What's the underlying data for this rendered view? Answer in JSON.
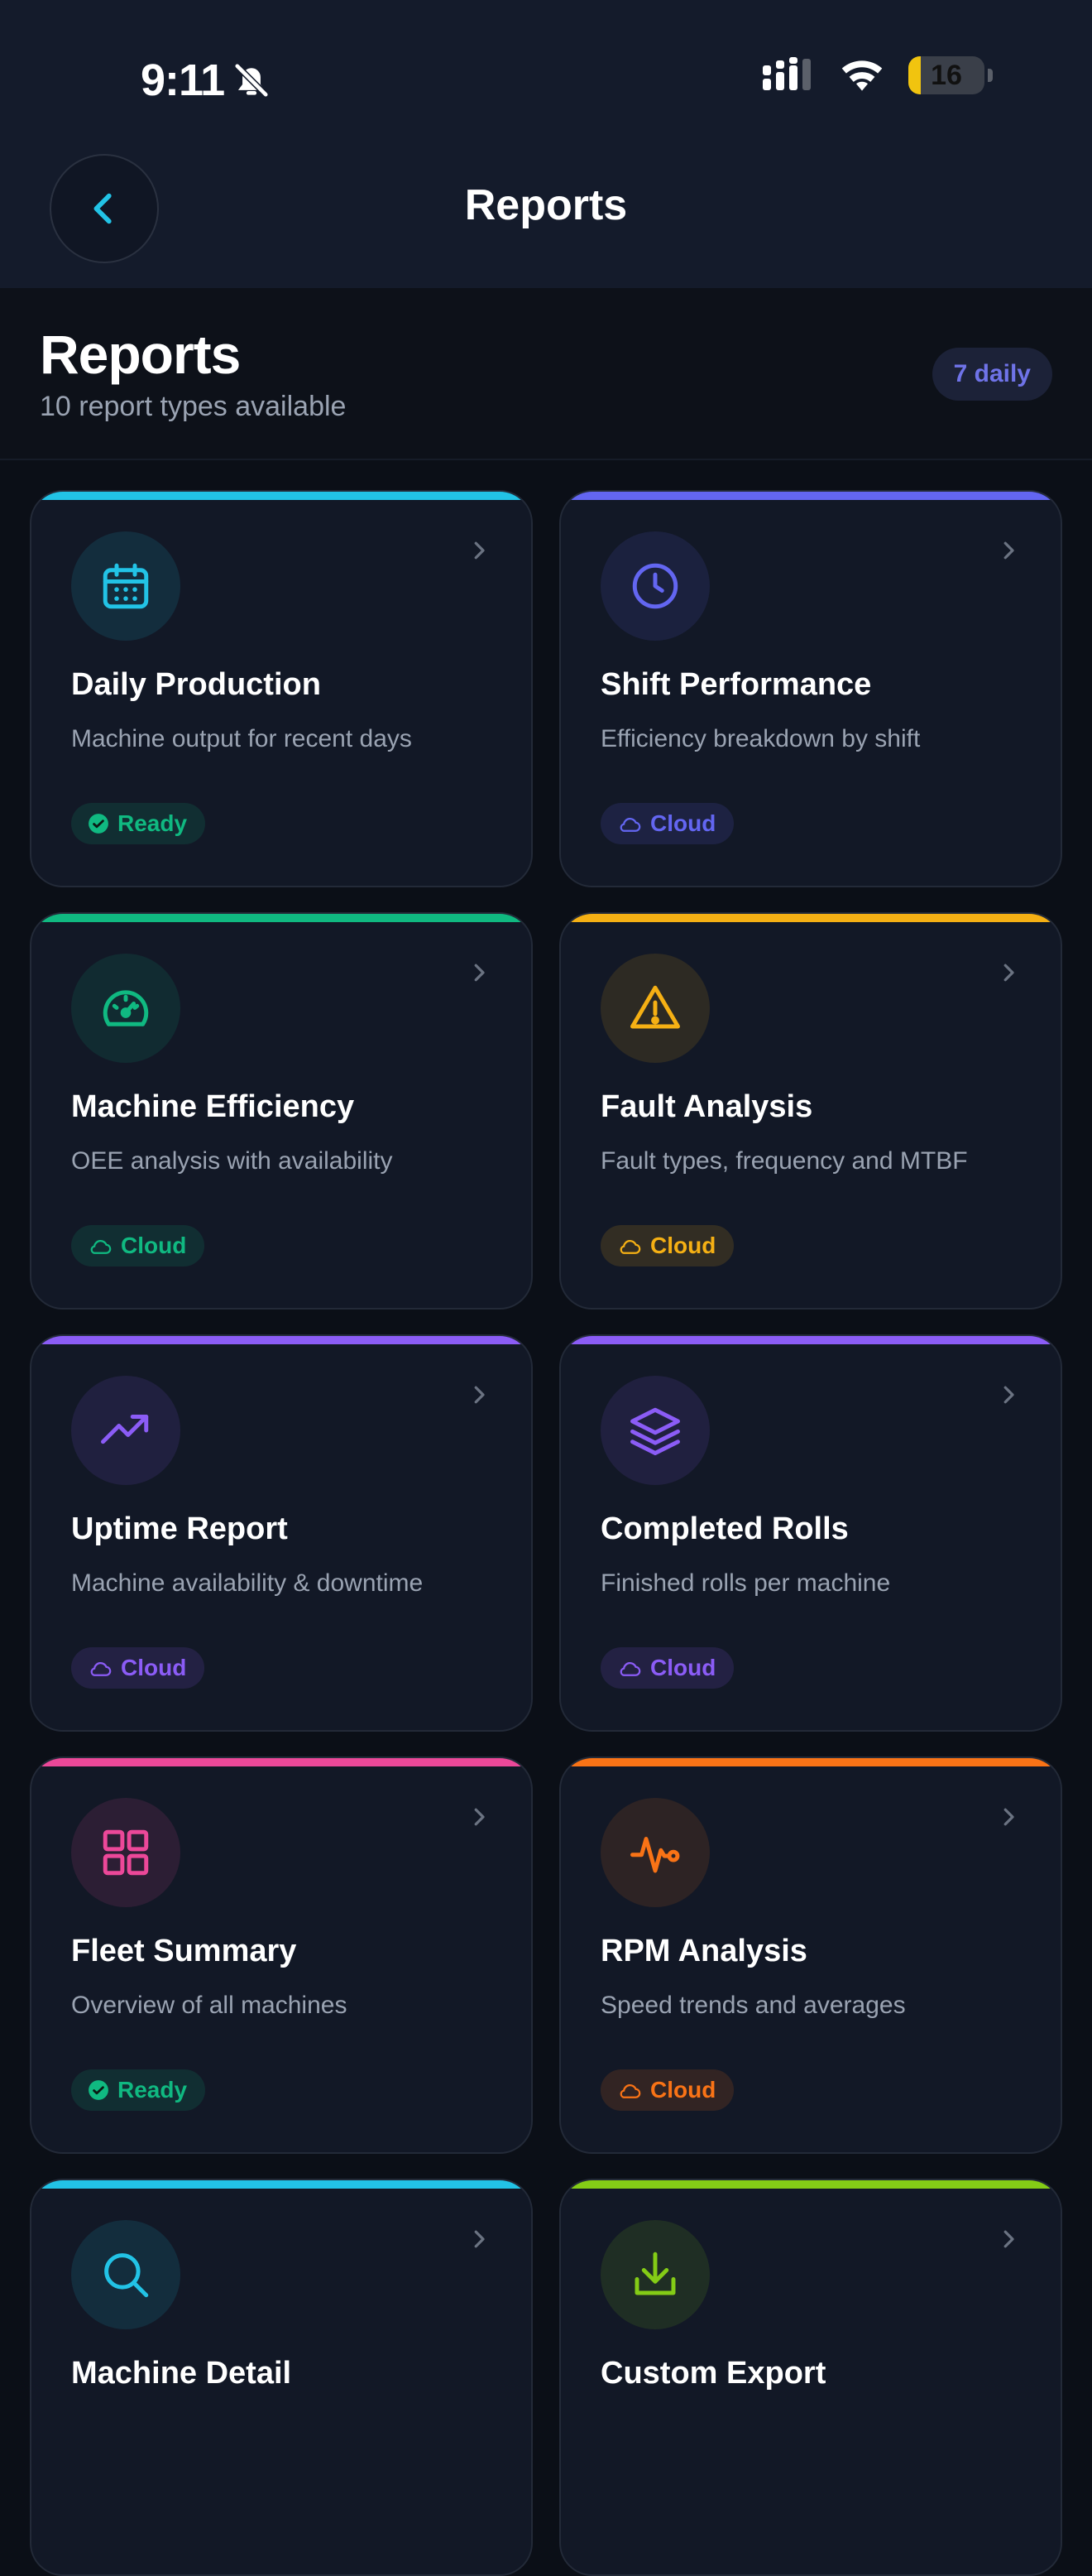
{
  "status_bar": {
    "time": "9:11",
    "battery": "16",
    "battery_level": 0.16
  },
  "nav": {
    "title": "Reports"
  },
  "header": {
    "title": "Reports",
    "subtitle": "10 report types available",
    "daily_badge": "7 daily"
  },
  "colors": {
    "cyan": "#22c3e6",
    "indigo": "#6366f1",
    "green": "#10b981",
    "amber": "#f5b014",
    "purple": "#8b5cf6",
    "pink": "#ec4899",
    "orange": "#f97316",
    "lime": "#84cc16"
  },
  "reports": [
    {
      "title": "Daily Production",
      "description": "Machine output for recent days",
      "badge": "Ready",
      "badge_kind": "ready",
      "icon": "calendar-icon",
      "color": "#22c3e6"
    },
    {
      "title": "Shift Performance",
      "description": "Efficiency breakdown by shift",
      "badge": "Cloud",
      "badge_kind": "cloud",
      "icon": "clock-icon",
      "color": "#6366f1"
    },
    {
      "title": "Machine Efficiency",
      "description": "OEE analysis with availability",
      "badge": "Cloud",
      "badge_kind": "cloud",
      "icon": "gauge-icon",
      "color": "#10b981"
    },
    {
      "title": "Fault Analysis",
      "description": "Fault types, frequency and MTBF",
      "badge": "Cloud",
      "badge_kind": "cloud",
      "icon": "warning-icon",
      "color": "#f5b014"
    },
    {
      "title": "Uptime Report",
      "description": "Machine availability & downtime",
      "badge": "Cloud",
      "badge_kind": "cloud",
      "icon": "trending-up-icon",
      "color": "#8b5cf6"
    },
    {
      "title": "Completed Rolls",
      "description": "Finished rolls per machine",
      "badge": "Cloud",
      "badge_kind": "cloud",
      "icon": "layers-icon",
      "color": "#8b5cf6"
    },
    {
      "title": "Fleet Summary",
      "description": "Overview of all machines",
      "badge": "Ready",
      "badge_kind": "ready",
      "icon": "grid-icon",
      "color": "#ec4899"
    },
    {
      "title": "RPM Analysis",
      "description": "Speed trends and averages",
      "badge": "Cloud",
      "badge_kind": "cloud",
      "icon": "pulse-icon",
      "color": "#f97316"
    },
    {
      "title": "Machine Detail",
      "description": "",
      "badge": "",
      "badge_kind": "",
      "icon": "search-icon",
      "color": "#22c3e6"
    },
    {
      "title": "Custom Export",
      "description": "",
      "badge": "",
      "badge_kind": "",
      "icon": "download-icon",
      "color": "#84cc16"
    }
  ]
}
